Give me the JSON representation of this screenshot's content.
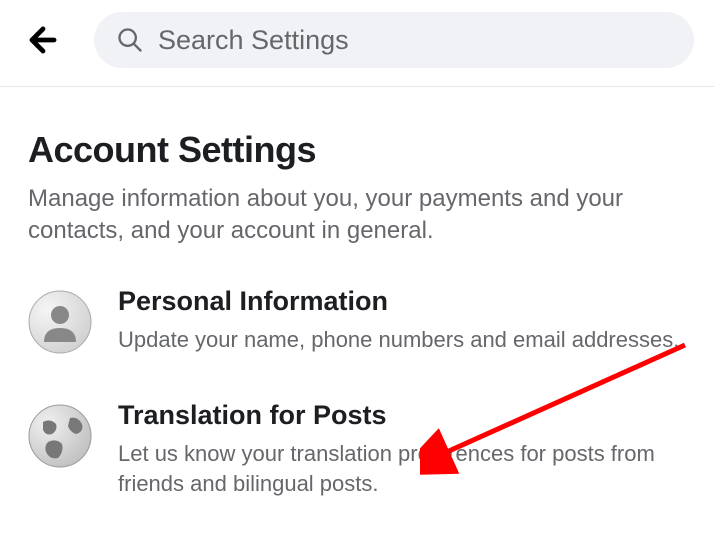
{
  "header": {
    "search_placeholder": "Search Settings"
  },
  "page": {
    "title": "Account Settings",
    "subtitle": "Manage information about you, your payments and your contacts, and your account in general."
  },
  "items": [
    {
      "title": "Personal Information",
      "description": "Update your name, phone numbers and email addresses."
    },
    {
      "title": "Translation for Posts",
      "description": "Let us know your translation preferences for posts from friends and bilingual posts."
    }
  ]
}
